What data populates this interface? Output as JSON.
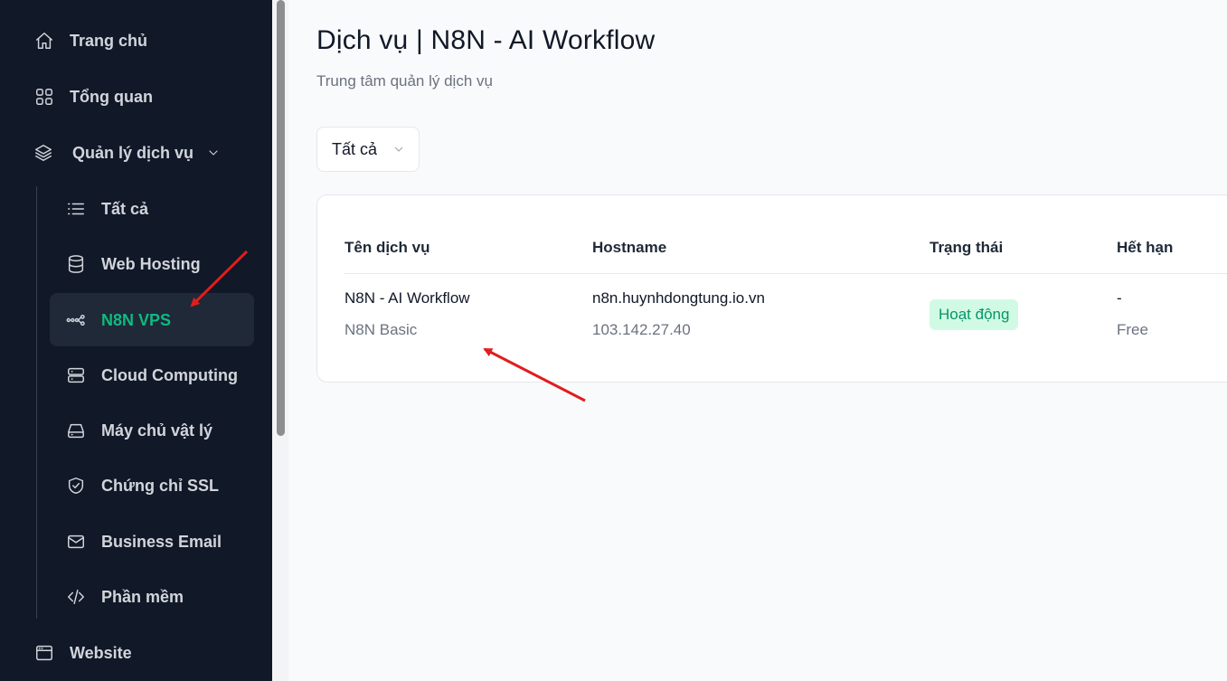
{
  "sidebar": {
    "items": [
      {
        "label": "Trang chủ",
        "icon": "home-icon"
      },
      {
        "label": "Tổng quan",
        "icon": "grid-icon"
      },
      {
        "label": "Quản lý dịch vụ",
        "icon": "layers-icon"
      }
    ],
    "sub_items": [
      {
        "label": "Tất cả",
        "icon": "list-icon"
      },
      {
        "label": "Web Hosting",
        "icon": "database-icon"
      },
      {
        "label": "N8N VPS",
        "icon": "workflow-icon"
      },
      {
        "label": "Cloud Computing",
        "icon": "server-icon"
      },
      {
        "label": "Máy chủ vật lý",
        "icon": "hard-drive-icon"
      },
      {
        "label": "Chứng chỉ SSL",
        "icon": "shield-check-icon"
      },
      {
        "label": "Business Email",
        "icon": "mail-icon"
      },
      {
        "label": "Phần mềm",
        "icon": "code-icon"
      }
    ],
    "bottom_item": {
      "label": "Website",
      "icon": "browser-icon"
    }
  },
  "main": {
    "title": "Dịch vụ | N8N - AI Workflow",
    "subtitle": "Trung tâm quản lý dịch vụ",
    "filter": {
      "selected": "Tất cả"
    },
    "table": {
      "headers": [
        "Tên dịch vụ",
        "Hostname",
        "Trạng thái",
        "Hết hạn"
      ],
      "rows": [
        {
          "name": "N8N - AI Workflow",
          "plan": "N8N Basic",
          "hostname": "n8n.huynhdongtung.io.vn",
          "ip": "103.142.27.40",
          "status": "Hoạt động",
          "expiry": "-",
          "billing": "Free"
        }
      ]
    }
  },
  "colors": {
    "sidebar_bg": "#111827",
    "active_text": "#10b981",
    "badge_bg": "#d1fae5",
    "badge_text": "#059669",
    "annotation_arrow": "#e11d1d"
  }
}
